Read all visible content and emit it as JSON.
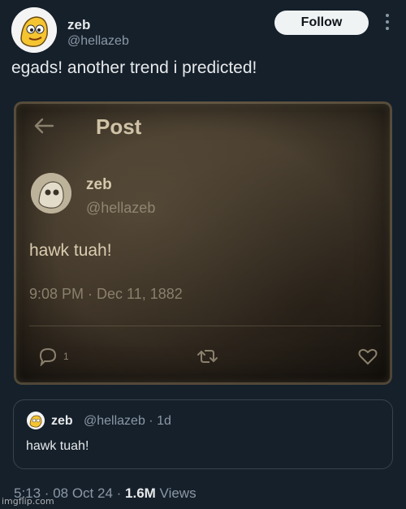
{
  "author": {
    "name": "zeb",
    "handle": "@hellazeb"
  },
  "follow_label": "Follow",
  "tweet_text": "egads! another trend i predicted!",
  "image": {
    "header_title": "Post",
    "author_name": "zeb",
    "author_handle": "@hellazeb",
    "text": "hawk tuah!",
    "timestamp": "9:08 PM · Dec 11, 1882",
    "reply_count": "1"
  },
  "quote": {
    "name": "zeb",
    "handle": "@hellazeb · 1d",
    "text": "hawk tuah!"
  },
  "meta": {
    "time_date": "5:13 · 08 Oct 24 · ",
    "views_count": "1.6M",
    "views_label": " Views"
  },
  "watermark": "imgflip.com",
  "colors": {
    "background": "#15202b",
    "follow_button": "#eff3f4",
    "muted_text": "#8b98a5",
    "border": "#38444d"
  },
  "icons": [
    "back-arrow-icon",
    "reply-icon",
    "retweet-icon",
    "like-icon",
    "more-icon"
  ]
}
